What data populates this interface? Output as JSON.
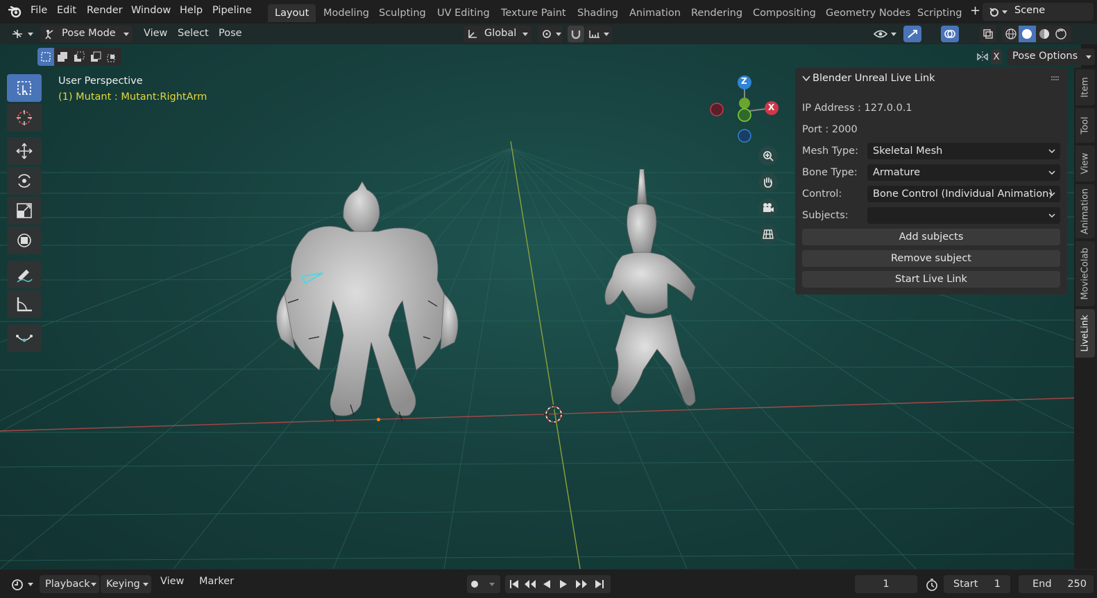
{
  "topbar": {
    "menus": [
      "File",
      "Edit",
      "Render",
      "Window",
      "Help",
      "Pipeline"
    ],
    "workspaces": [
      "Layout",
      "Modeling",
      "Sculpting",
      "UV Editing",
      "Texture Paint",
      "Shading",
      "Animation",
      "Rendering",
      "Compositing",
      "Geometry Nodes",
      "Scripting"
    ],
    "active_workspace": "Layout",
    "add_glyph": "+",
    "scene": "Scene"
  },
  "header": {
    "mode": "Pose Mode",
    "menus": [
      "View",
      "Select",
      "Pose"
    ],
    "orientation": "Global",
    "pose_options": "Pose Options",
    "x_label": "X"
  },
  "viewport": {
    "title": "User Perspective",
    "subtitle": "(1) Mutant : Mutant:RightArm",
    "gizmo": {
      "z": "Z",
      "x": "X"
    }
  },
  "npanel": {
    "title": "Blender Unreal Live Link",
    "ip": "IP Address : 127.0.0.1",
    "port": "Port : 2000",
    "mesh_type_label": "Mesh Type:",
    "mesh_type_value": "Skeletal Mesh",
    "bone_type_label": "Bone Type:",
    "bone_type_value": "Armature",
    "control_label": "Control:",
    "control_value": "Bone Control (Individual Animation)",
    "subjects_label": "Subjects:",
    "subjects_value": "",
    "add_subjects": "Add subjects",
    "remove_subject": "Remove subject",
    "start_live_link": "Start Live Link"
  },
  "sidetabs": [
    "Item",
    "Tool",
    "View",
    "Animation",
    "MovieColab",
    "LiveLink"
  ],
  "active_sidetab": "LiveLink",
  "timeline": {
    "playback": "Playback",
    "keying": "Keying",
    "view": "View",
    "marker": "Marker",
    "current_frame": "1",
    "start_label": "Start",
    "start_value": "1",
    "end_label": "End",
    "end_value": "250"
  },
  "colors": {
    "accent": "#4a74b8",
    "x_axis": "#d0374b",
    "y_axis": "#6aa52c",
    "z_axis": "#2f84d6",
    "status_yellow": "#e6d83a"
  }
}
